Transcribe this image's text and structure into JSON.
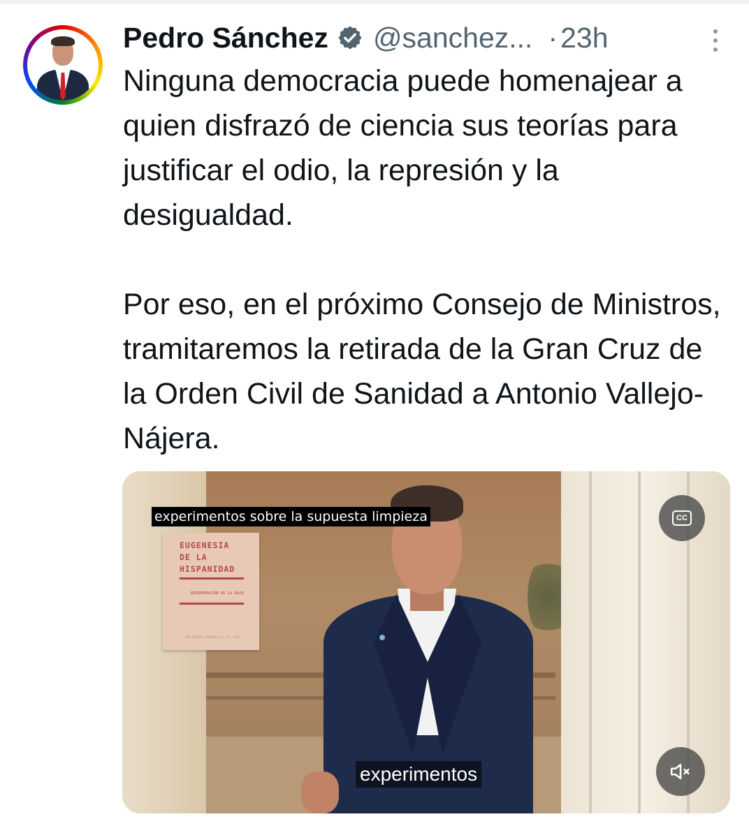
{
  "tweet": {
    "author_name": "Pedro Sánchez",
    "handle": "@sanchez...",
    "separator": "·",
    "time": "23h",
    "text_paragraphs": [
      "Ninguna democracia puede homenajear a quien disfrazó de ciencia sus teorías para justificar el odio, la represión y la desigualdad.",
      "Por eso, en el próximo Consejo de Ministros, tramitaremos la retirada de la Gran Cruz de la Orden Civil de Sanidad a Antonio Vallejo-Nájera."
    ],
    "verified_badge_color": "#536471",
    "avatar_icon": "profile-photo-rainbow-border"
  },
  "media": {
    "subtitle_top": "experimentos sobre la supuesta limpieza",
    "subtitle_bottom": "experimentos",
    "cc_label": "CC",
    "book_title": "EUGENESIA\nDE LA\nHISPANIDAD",
    "book_subtitle": "REGENERACIÓN DE LA RAZA",
    "book_footer": "EDITORIAL ESPAÑOLA S. A. 1937",
    "mute_icon": "speaker-muted-icon"
  },
  "colors": {
    "text": "#0f1419",
    "secondary": "#536471",
    "control_bg": "#464646"
  }
}
